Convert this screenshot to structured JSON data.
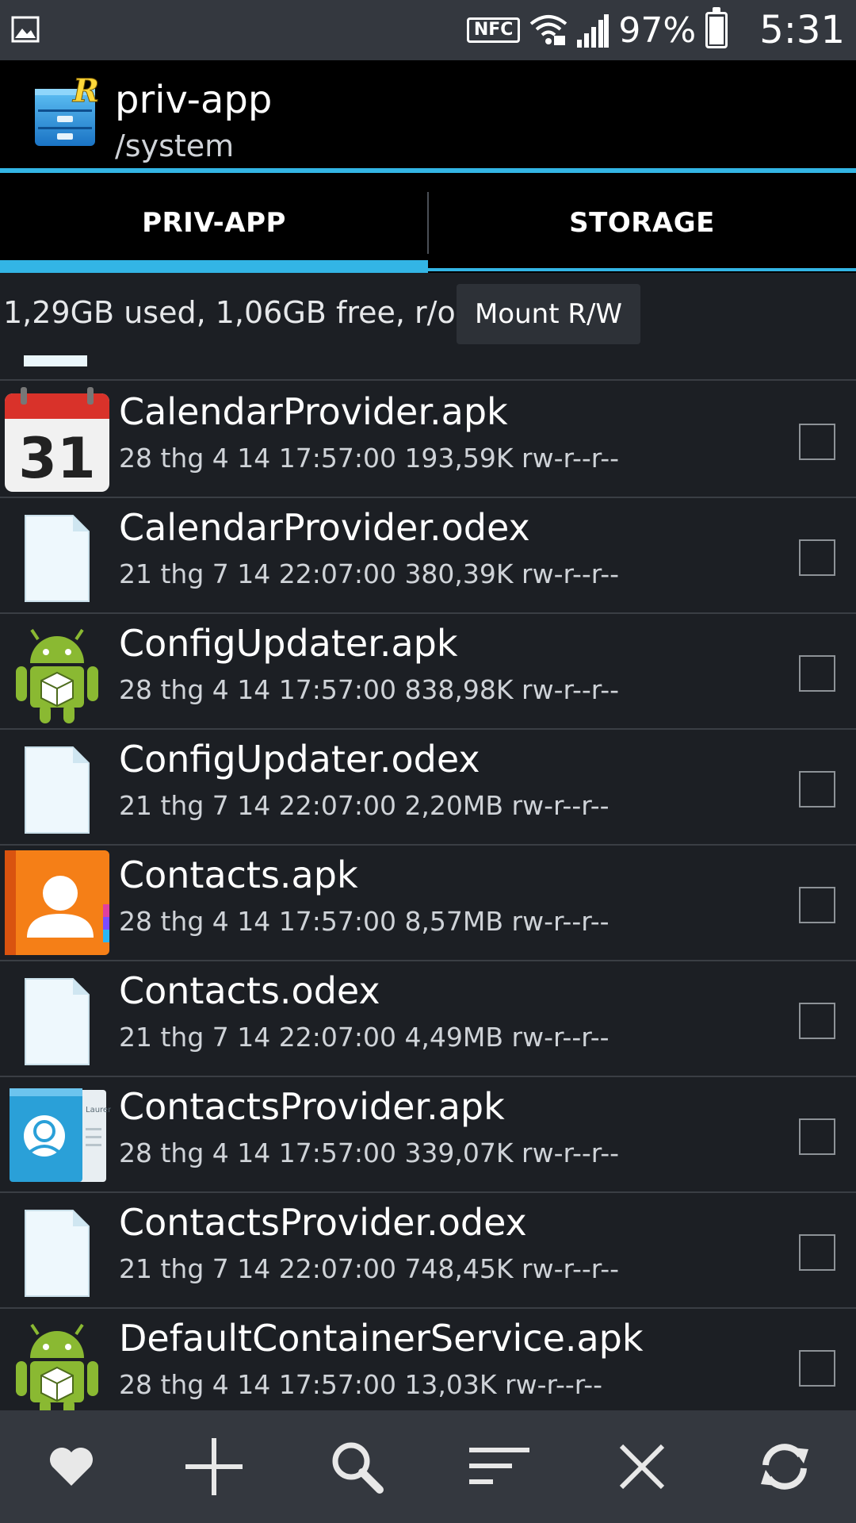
{
  "status_bar": {
    "nfc_label": "NFC",
    "battery": "97%",
    "time": "5:31"
  },
  "header": {
    "title": "priv-app",
    "subtitle": "/system"
  },
  "tabs": [
    {
      "label": "PRIV-APP",
      "active": true
    },
    {
      "label": "STORAGE",
      "active": false
    }
  ],
  "info": {
    "text": "1,29GB used, 1,06GB free, r/o",
    "mount_label": "Mount R/W"
  },
  "files": [
    {
      "name": "CalendarProvider.apk",
      "meta": "28 thg 4 14 17:57:00  193,59K  rw-r--r--",
      "icon": "calendar-icon"
    },
    {
      "name": "CalendarProvider.odex",
      "meta": "21 thg 7 14 22:07:00  380,39K  rw-r--r--",
      "icon": "file-icon"
    },
    {
      "name": "ConfigUpdater.apk",
      "meta": "28 thg 4 14 17:57:00  838,98K  rw-r--r--",
      "icon": "android-icon"
    },
    {
      "name": "ConfigUpdater.odex",
      "meta": "21 thg 7 14 22:07:00  2,20MB  rw-r--r--",
      "icon": "file-icon"
    },
    {
      "name": "Contacts.apk",
      "meta": "28 thg 4 14 17:57:00  8,57MB  rw-r--r--",
      "icon": "contacts-icon"
    },
    {
      "name": "Contacts.odex",
      "meta": "21 thg 7 14 22:07:00  4,49MB  rw-r--r--",
      "icon": "file-icon"
    },
    {
      "name": "ContactsProvider.apk",
      "meta": "28 thg 4 14 17:57:00  339,07K  rw-r--r--",
      "icon": "contacts-provider-icon"
    },
    {
      "name": "ContactsProvider.odex",
      "meta": "21 thg 7 14 22:07:00  748,45K  rw-r--r--",
      "icon": "file-icon"
    },
    {
      "name": "DefaultContainerService.apk",
      "meta": "28 thg 4 14 17:57:00  13,03K  rw-r--r--",
      "icon": "android-icon"
    }
  ],
  "calendar_day": "31",
  "contacts_card_text": "Lauren Ipsum",
  "toolbar": [
    "favorite-icon",
    "add-icon",
    "search-icon",
    "sort-icon",
    "close-icon",
    "refresh-icon"
  ],
  "colors": {
    "accent": "#33b5e5",
    "background": "#1c1f24",
    "toolbar": "#34383f"
  }
}
